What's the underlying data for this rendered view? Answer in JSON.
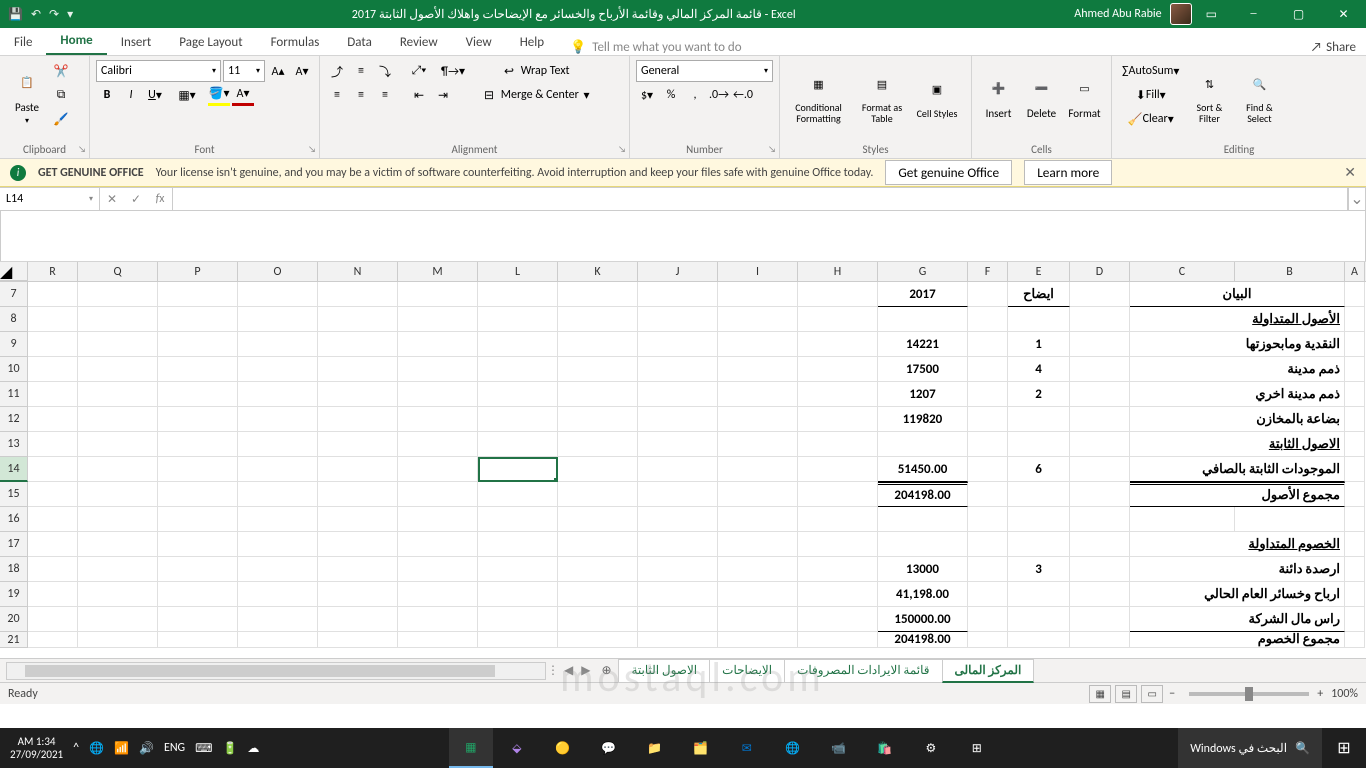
{
  "titlebar": {
    "title": "2017 قائمة المركز المالي وقائمة الأرباح والخسائر مع الإيضاحات واهلاك الأصول الثابتة  -  Excel",
    "user": "Ahmed Abu Rabie"
  },
  "tabs": {
    "file": "File",
    "home": "Home",
    "insert": "Insert",
    "layout": "Page Layout",
    "formulas": "Formulas",
    "data": "Data",
    "review": "Review",
    "view": "View",
    "help": "Help",
    "tellme": "Tell me what you want to do",
    "share": "Share"
  },
  "ribbon": {
    "clipboard": {
      "label": "Clipboard",
      "paste": "Paste"
    },
    "font": {
      "label": "Font",
      "name": "Calibri",
      "size": "11"
    },
    "alignment": {
      "label": "Alignment",
      "wrap": "Wrap Text",
      "merge": "Merge & Center"
    },
    "number": {
      "label": "Number",
      "format": "General"
    },
    "styles": {
      "label": "Styles",
      "cond": "Conditional Formatting",
      "table": "Format as Table",
      "cell": "Cell Styles"
    },
    "cells": {
      "label": "Cells",
      "insert": "Insert",
      "delete": "Delete",
      "format": "Format"
    },
    "editing": {
      "label": "Editing",
      "sum": "AutoSum",
      "fill": "Fill",
      "clear": "Clear",
      "sort": "Sort & Filter",
      "find": "Find & Select"
    }
  },
  "warn": {
    "title": "GET GENUINE OFFICE",
    "msg": "Your license isn't genuine, and you may be a victim of software counterfeiting. Avoid interruption and keep your files safe with genuine Office today.",
    "btn1": "Get genuine Office",
    "btn2": "Learn more"
  },
  "namebox": "L14",
  "cols": [
    "R",
    "Q",
    "P",
    "O",
    "N",
    "M",
    "L",
    "K",
    "J",
    "I",
    "H",
    "G",
    "F",
    "E",
    "D",
    "C",
    "B",
    "A"
  ],
  "colW": {
    "R": 50,
    "Q": 80,
    "P": 80,
    "O": 80,
    "N": 80,
    "M": 80,
    "L": 80,
    "K": 80,
    "J": 80,
    "I": 80,
    "H": 80,
    "G": 90,
    "F": 40,
    "E": 62,
    "D": 60,
    "C": 105,
    "B": 110,
    "A": 20
  },
  "rows": [
    {
      "n": 7,
      "G": "2017",
      "E": "ايضاح",
      "C": "البيان",
      "hdr": true
    },
    {
      "n": 8,
      "C": "الأصول المتداولة",
      "u": true
    },
    {
      "n": 9,
      "G": "14221",
      "E": "1",
      "C": "النقدية ومابحوزتها"
    },
    {
      "n": 10,
      "G": "17500",
      "E": "4",
      "C": "ذمم مدينة"
    },
    {
      "n": 11,
      "G": "1207",
      "E": "2",
      "C": "ذمم مدينة  اخري"
    },
    {
      "n": 12,
      "G": "119820",
      "C": "بضاعة بالمخازن"
    },
    {
      "n": 13,
      "C": "الاصول الثابتة",
      "u": true,
      "ubG": true
    },
    {
      "n": 14,
      "G": "51450.00",
      "E": "6",
      "C": "الموجودات الثابتة بالصافي",
      "sel": true,
      "ubG": true
    },
    {
      "n": 15,
      "G": "204198.00",
      "C": "مجموع الأصول",
      "dblTop": true
    },
    {
      "n": 16
    },
    {
      "n": 17,
      "C": "الخصوم المتداولة",
      "u": true
    },
    {
      "n": 18,
      "G": "13000",
      "E": "3",
      "C": "ارصدة دائنة"
    },
    {
      "n": 19,
      "G": "41,198.00",
      "C": "ارباح وخسائر العام الحالي"
    },
    {
      "n": 20,
      "G": "150000.00",
      "C": "راس مال الشركة",
      "ubG": true
    },
    {
      "n": 21,
      "G": "204198.00",
      "C": "مجموع الخصوم",
      "cut": true
    }
  ],
  "sheetTabs": [
    "المركز المالى",
    "قائمة الايرادات المصروفات",
    "الايضاحات",
    "الاصول الثابتة"
  ],
  "status": {
    "ready": "Ready",
    "zoom": "100%"
  },
  "taskbar": {
    "time": "AM 1:34",
    "date": "27/09/2021",
    "search": "البحث في Windows"
  },
  "watermark": "mostaql.com"
}
